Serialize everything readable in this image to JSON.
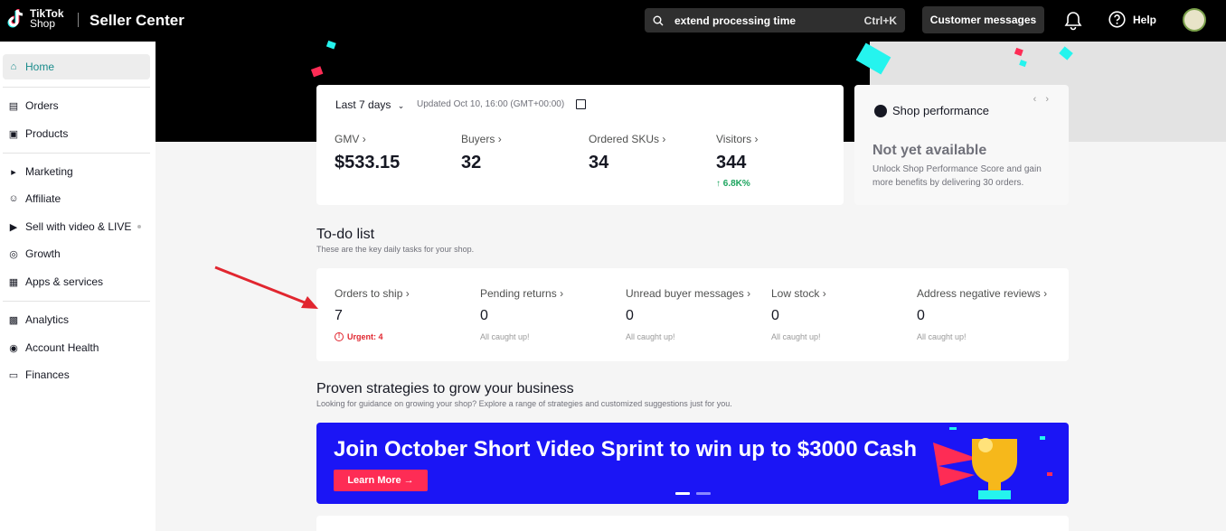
{
  "header": {
    "logo_line1": "TikTok",
    "logo_line2": "Shop",
    "app_title": "Seller Center",
    "search_text": "extend processing time",
    "search_shortcut": "Ctrl+K",
    "customer_messages": "Customer messages",
    "help": "Help",
    "icons": [
      "search-icon",
      "bell-icon",
      "help-icon",
      "avatar"
    ]
  },
  "sidebar": {
    "items": [
      {
        "label": "Home",
        "icon": "home-icon",
        "active": true
      },
      {
        "label": "Orders",
        "icon": "clipboard-icon"
      },
      {
        "label": "Products",
        "icon": "box-icon"
      },
      {
        "label": "Marketing",
        "icon": "megaphone-icon"
      },
      {
        "label": "Affiliate",
        "icon": "people-icon"
      },
      {
        "label": "Sell with video & LIVE",
        "icon": "video-icon"
      },
      {
        "label": "Growth",
        "icon": "medal-icon"
      },
      {
        "label": "Apps & services",
        "icon": "apps-icon"
      },
      {
        "label": "Analytics",
        "icon": "bar-chart-icon"
      },
      {
        "label": "Account Health",
        "icon": "trophy-icon"
      },
      {
        "label": "Finances",
        "icon": "card-icon"
      }
    ]
  },
  "metrics": {
    "range": "Last 7 days",
    "updated": "Updated Oct 10, 16:00 (GMT+00:00)",
    "items": [
      {
        "label": "GMV",
        "value": "$533.15",
        "delta": ""
      },
      {
        "label": "Buyers",
        "value": "32",
        "delta": ""
      },
      {
        "label": "Ordered SKUs",
        "value": "34",
        "delta": ""
      },
      {
        "label": "Visitors",
        "value": "344",
        "delta": "6.8K%"
      }
    ]
  },
  "performance": {
    "title": "Shop performance",
    "status": "Not yet available",
    "description": "Unlock Shop Performance Score and gain more benefits by delivering 30 orders."
  },
  "todo": {
    "title": "To-do list",
    "subtitle": "These are the key daily tasks for your shop.",
    "items": [
      {
        "label": "Orders to ship",
        "value": "7",
        "status": "Urgent: 4",
        "urgent": true
      },
      {
        "label": "Pending returns",
        "value": "0",
        "status": "All caught up!"
      },
      {
        "label": "Unread buyer messages",
        "value": "0",
        "status": "All caught up!"
      },
      {
        "label": "Low stock",
        "value": "0",
        "status": "All caught up!"
      },
      {
        "label": "Address negative reviews",
        "value": "0",
        "status": "All caught up!"
      }
    ]
  },
  "strategies": {
    "title": "Proven strategies to grow your business",
    "subtitle": "Looking for guidance on growing your shop? Explore a range of strategies and customized suggestions just for you.",
    "banner_title": "Join October Short Video Sprint to win up to $3000 Cash",
    "banner_button": "Learn More →"
  },
  "colors": {
    "accent": "#1a8c8c",
    "banner_blue": "#1b15f5",
    "cta_pink": "#fe2c55",
    "urgent_red": "#e1262f",
    "positive_green": "#1da55f"
  }
}
